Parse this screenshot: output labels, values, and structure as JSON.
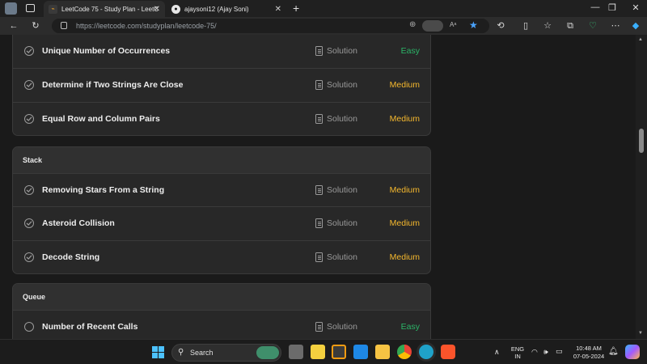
{
  "browser": {
    "tabs": [
      {
        "title": "LeetCode 75 - Study Plan - LeetC",
        "active": true
      },
      {
        "title": "ajaysoni12 (Ajay Soni)",
        "active": false
      }
    ],
    "url": "https://leetcode.com/studyplan/leetcode-75/"
  },
  "sections": [
    {
      "header": "",
      "problems": [
        {
          "title": "Unique Number of Occurrences",
          "solution": "Solution",
          "difficulty": "Easy",
          "solved": true
        },
        {
          "title": "Determine if Two Strings Are Close",
          "solution": "Solution",
          "difficulty": "Medium",
          "solved": true
        },
        {
          "title": "Equal Row and Column Pairs",
          "solution": "Solution",
          "difficulty": "Medium",
          "solved": true
        }
      ]
    },
    {
      "header": "Stack",
      "problems": [
        {
          "title": "Removing Stars From a String",
          "solution": "Solution",
          "difficulty": "Medium",
          "solved": true
        },
        {
          "title": "Asteroid Collision",
          "solution": "Solution",
          "difficulty": "Medium",
          "solved": true
        },
        {
          "title": "Decode String",
          "solution": "Solution",
          "difficulty": "Medium",
          "solved": true
        }
      ]
    },
    {
      "header": "Queue",
      "problems": [
        {
          "title": "Number of Recent Calls",
          "solution": "Solution",
          "difficulty": "Easy",
          "solved": false
        }
      ]
    }
  ],
  "taskbar": {
    "search_label": "Search",
    "language": "ENG",
    "region": "IN",
    "time": "10:48 AM",
    "date": "07-05-2024"
  },
  "colors": {
    "easy": "#2bb568",
    "medium": "#f5b82e",
    "background": "#1a1a1a",
    "card": "#282828"
  }
}
